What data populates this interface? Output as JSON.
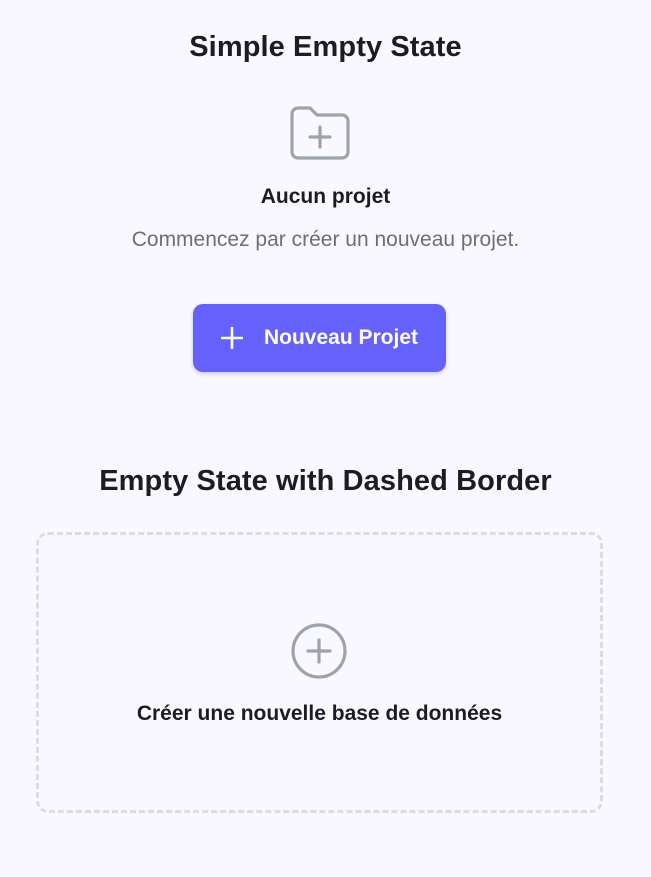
{
  "simple": {
    "title": "Simple Empty State",
    "icon": "folder-plus-icon",
    "heading": "Aucun projet",
    "description": "Commencez par créer un nouveau projet.",
    "button_label": "Nouveau Projet",
    "button_icon": "plus-icon"
  },
  "dashed": {
    "title": "Empty State with Dashed Border",
    "icon": "circle-plus-icon",
    "label": "Créer une nouvelle base de données"
  },
  "colors": {
    "background": "#faf8ff",
    "accent": "#6461fd",
    "icon_gray": "#9ca3af",
    "muted_text": "#6b6f7b",
    "dashed_border": "#dcdce2"
  }
}
